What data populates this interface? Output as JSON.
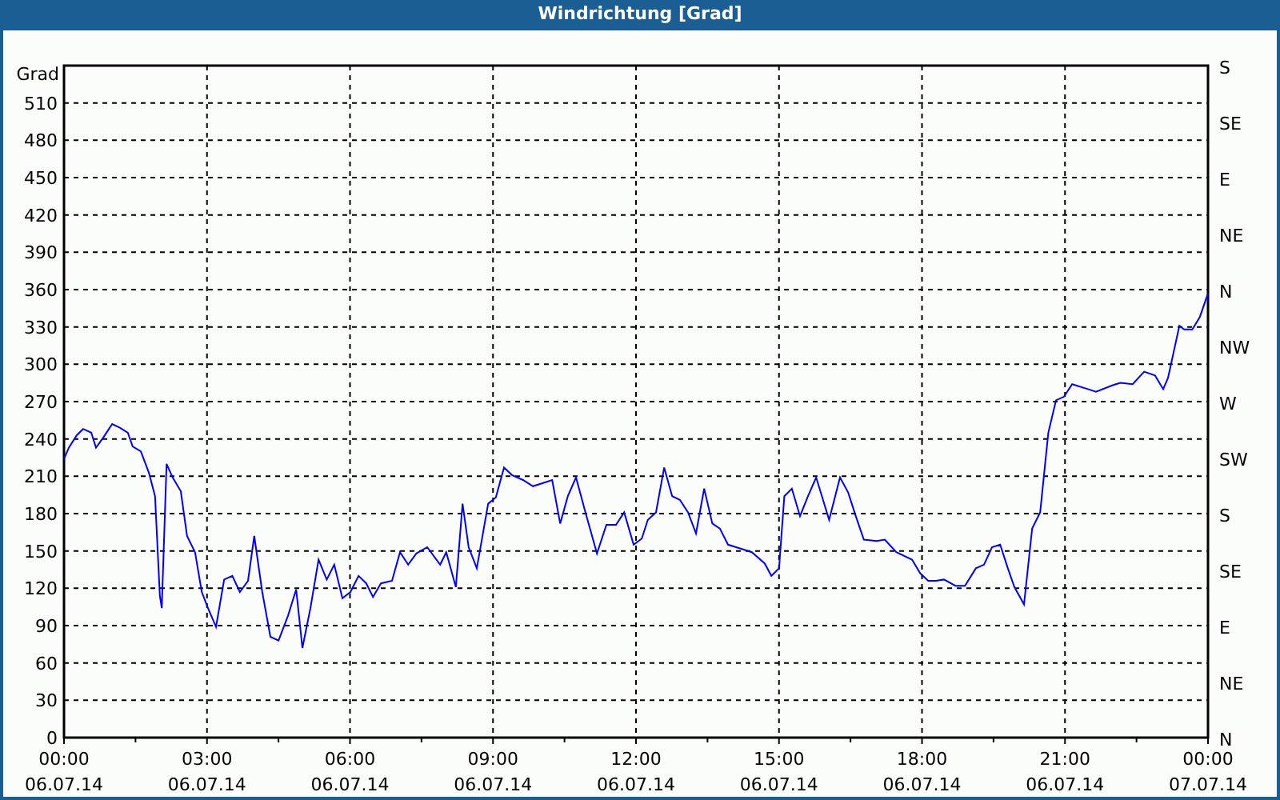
{
  "window": {
    "title": "Windrichtung [Grad]"
  },
  "chart": {
    "y_unit": "Grad",
    "right_axis_labels": [
      "S",
      "SE",
      "E",
      "NE",
      "N",
      "NW",
      "W",
      "SW",
      "S",
      "SE",
      "E",
      "NE",
      "N"
    ],
    "xtick_dates": [
      "06.07.14",
      "06.07.14",
      "06.07.14",
      "06.07.14",
      "06.07.14",
      "06.07.14",
      "06.07.14",
      "06.07.14",
      "07.07.14"
    ],
    "chart_data": {
      "type": "line",
      "grid": true,
      "xlim": [
        0,
        24
      ],
      "ylim": [
        0,
        540
      ],
      "xticks": [
        {
          "value": 0,
          "label": "00:00"
        },
        {
          "value": 3,
          "label": "03:00"
        },
        {
          "value": 6,
          "label": "06:00"
        },
        {
          "value": 9,
          "label": "09:00"
        },
        {
          "value": 12,
          "label": "12:00"
        },
        {
          "value": 15,
          "label": "15:00"
        },
        {
          "value": 18,
          "label": "18:00"
        },
        {
          "value": 21,
          "label": "21:00"
        },
        {
          "value": 24,
          "label": "00:00"
        }
      ],
      "yticks": [
        0,
        30,
        60,
        90,
        120,
        150,
        180,
        210,
        240,
        270,
        300,
        330,
        360,
        390,
        420,
        450,
        480,
        510
      ],
      "x": [
        0,
        0.1,
        0.27,
        0.4,
        0.57,
        0.67,
        0.84,
        1.01,
        1.17,
        1.34,
        1.44,
        1.61,
        1.78,
        1.91,
        2.01,
        2.05,
        2.15,
        2.28,
        2.45,
        2.58,
        2.75,
        2.89,
        3.02,
        3.19,
        3.36,
        3.53,
        3.69,
        3.86,
        3.99,
        4.16,
        4.33,
        4.5,
        4.7,
        4.87,
        5.0,
        5.17,
        5.34,
        5.51,
        5.67,
        5.84,
        6.01,
        6.18,
        6.34,
        6.48,
        6.65,
        6.88,
        7.05,
        7.22,
        7.39,
        7.62,
        7.89,
        8.02,
        8.22,
        8.36,
        8.49,
        8.66,
        8.9,
        9.06,
        9.23,
        9.4,
        9.63,
        9.84,
        10.24,
        10.41,
        10.57,
        10.74,
        10.94,
        11.18,
        11.38,
        11.58,
        11.75,
        11.95,
        12.12,
        12.25,
        12.42,
        12.59,
        12.76,
        12.92,
        13.09,
        13.26,
        13.43,
        13.6,
        13.76,
        13.93,
        14.1,
        14.43,
        14.7,
        14.84,
        15.0,
        15.11,
        15.27,
        15.44,
        15.61,
        15.78,
        16.05,
        16.28,
        16.45,
        16.62,
        16.78,
        17.05,
        17.22,
        17.46,
        17.79,
        17.96,
        18.13,
        18.29,
        18.46,
        18.7,
        18.9,
        19.13,
        19.3,
        19.47,
        19.64,
        19.8,
        19.94,
        20.14,
        20.31,
        20.48,
        20.65,
        20.81,
        20.98,
        21.15,
        21.48,
        21.65,
        21.99,
        22.16,
        22.42,
        22.66,
        22.89,
        23.06,
        23.16,
        23.4,
        23.5,
        23.67,
        23.83,
        24
      ],
      "series": [
        {
          "color": "#0000ff",
          "values": [
            224,
            233,
            243,
            248,
            245,
            233,
            242,
            252,
            249,
            245,
            234,
            230,
            213,
            194,
            114,
            104,
            220,
            209,
            198,
            162,
            149,
            117,
            104,
            89,
            127,
            130,
            117,
            126,
            162,
            117,
            81,
            78,
            98,
            119,
            72,
            104,
            143,
            127,
            139,
            112,
            117,
            130,
            124,
            113,
            124,
            126,
            149,
            139,
            148,
            153,
            139,
            149,
            121,
            188,
            153,
            136,
            188,
            193,
            217,
            211,
            207,
            202,
            207,
            172,
            194,
            209,
            181,
            148,
            171,
            171,
            181,
            155,
            160,
            175,
            181,
            217,
            194,
            191,
            181,
            164,
            200,
            172,
            168,
            155,
            153,
            149,
            140,
            130,
            136,
            194,
            200,
            178,
            194,
            209,
            175,
            209,
            197,
            177,
            159,
            158,
            159,
            149,
            143,
            132,
            126,
            126,
            127,
            122,
            122,
            136,
            139,
            153,
            155,
            136,
            121,
            107,
            168,
            181,
            245,
            271,
            274,
            284,
            280,
            278,
            283,
            285,
            284,
            294,
            291,
            280,
            289,
            331,
            328,
            328,
            338,
            357
          ]
        }
      ]
    }
  }
}
